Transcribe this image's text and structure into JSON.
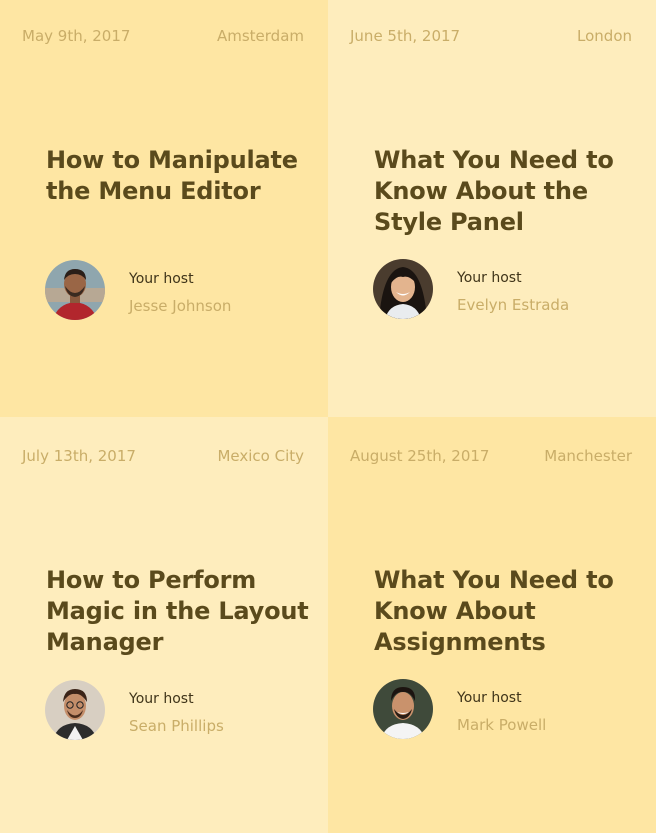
{
  "cards": [
    {
      "date": "May 9th, 2017",
      "city": "Amsterdam",
      "title": "How to Manipulate the Menu Editor",
      "host_label": "Your host",
      "host_name": "Jesse Johnson",
      "bg": "#fee6a3"
    },
    {
      "date": "June 5th, 2017",
      "city": "London",
      "title": "What You Need to Know About the Style Panel",
      "host_label": "Your host",
      "host_name": "Evelyn Estrada",
      "bg": "#feedbd"
    },
    {
      "date": "July 13th, 2017",
      "city": "Mexico City",
      "title": "How to Perform Magic in the Layout Manager",
      "host_label": "Your host",
      "host_name": "Sean Phillips",
      "bg": "#feedbd"
    },
    {
      "date": "August 25th, 2017",
      "city": "Manchester",
      "title": "What You Need to Know About Assignments",
      "host_label": "Your host",
      "host_name": "Mark Powell",
      "bg": "#fee6a3"
    }
  ],
  "colors": {
    "meta_text": "#c9ad68",
    "title_text": "#5a4a1c",
    "label_text": "#3f3419"
  }
}
